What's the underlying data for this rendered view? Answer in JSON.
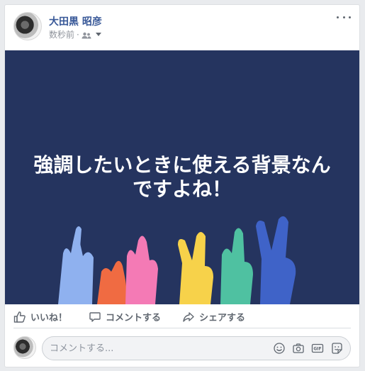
{
  "post": {
    "author": "大田黒 昭彦",
    "timestamp": "数秒前",
    "separator": "·",
    "privacy_icon": "friends-icon",
    "menu_icon": "more-icon"
  },
  "banner": {
    "text": "強調したいときに使える背景なんですよね！",
    "background_color": "#25345f"
  },
  "actions": {
    "like_label": "いいね！",
    "comment_label": "コメントする",
    "share_label": "シェアする"
  },
  "comment": {
    "placeholder": "コメントする...",
    "tools": [
      "emoji-icon",
      "camera-icon",
      "gif-icon",
      "sticker-icon"
    ]
  }
}
